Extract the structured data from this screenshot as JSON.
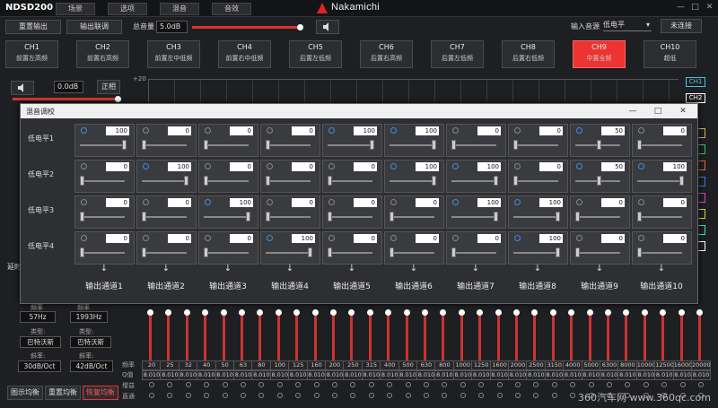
{
  "app_title": "NDSD200",
  "menu": [
    "场景",
    "选项",
    "混音",
    "音效"
  ],
  "logo": "Nakamichi",
  "window_controls": [
    "—",
    "□",
    "✕"
  ],
  "toolbar": {
    "reset_output": "重置输出",
    "output_link": "输出联调",
    "total_volume_label": "总音量",
    "total_volume_value": "5.0dB",
    "input_source_label": "输入音源",
    "input_source_value": "低电平",
    "connect_status": "未连接"
  },
  "channels": [
    {
      "name": "CH1",
      "sub": "前置左高频"
    },
    {
      "name": "CH2",
      "sub": "前置右高频"
    },
    {
      "name": "CH3",
      "sub": "前置左中低频"
    },
    {
      "name": "CH4",
      "sub": "前置右中低频"
    },
    {
      "name": "CH5",
      "sub": "后置左低频"
    },
    {
      "name": "CH6",
      "sub": "后置右高频"
    },
    {
      "name": "CH7",
      "sub": "后置左低频"
    },
    {
      "name": "CH8",
      "sub": "后置右低频"
    },
    {
      "name": "CH9",
      "sub": "中置全频"
    },
    {
      "name": "CH10",
      "sub": "超低"
    }
  ],
  "active_channel": "CH9",
  "channel_control": {
    "volume": "0.0dB",
    "phase": "正相"
  },
  "graph": {
    "y_top": "+20"
  },
  "side_channels": [
    "CH1",
    "CH2"
  ],
  "mixer": {
    "title": "混音调校",
    "rows": [
      "低电平1",
      "低电平2",
      "低电平3",
      "低电平4"
    ],
    "outputs": [
      "输出通道1",
      "输出通道2",
      "输出通道3",
      "输出通道4",
      "输出通道5",
      "输出通道6",
      "输出通道7",
      "输出通道8",
      "输出通道9",
      "输出通道10"
    ],
    "values": [
      [
        100,
        0,
        0,
        0,
        100,
        100,
        0,
        0,
        50,
        0
      ],
      [
        0,
        100,
        0,
        0,
        0,
        100,
        100,
        0,
        50,
        100
      ],
      [
        0,
        0,
        100,
        0,
        0,
        0,
        100,
        100,
        0,
        0
      ],
      [
        0,
        0,
        0,
        100,
        0,
        0,
        0,
        100,
        0,
        0
      ]
    ],
    "arrow": "↓"
  },
  "left_panel": {
    "delay_label": "延时",
    "hp_freq_label": "频率",
    "hp_freq": "57Hz",
    "lp_freq_label": "频率",
    "lp_freq": "1993Hz",
    "type_label": "类型:",
    "hp_type": "巴特沃斯",
    "lp_type": "巴特沃斯",
    "slope_label": "斜率:",
    "hp_slope": "30dB/Oct",
    "lp_slope": "42dB/Oct"
  },
  "eq": {
    "freq_label": "频率",
    "q_label": "Q值",
    "gain_label": "增益",
    "bypass_label": "直通",
    "freqs": [
      "20",
      "25",
      "32",
      "40",
      "50",
      "63",
      "80",
      "100",
      "125",
      "160",
      "200",
      "250",
      "315",
      "400",
      "500",
      "630",
      "800",
      "1000",
      "1250",
      "1600",
      "2000",
      "2500",
      "3150",
      "4000",
      "5000",
      "6300",
      "8000",
      "10000",
      "12500",
      "16000",
      "20000"
    ],
    "q": "8.010",
    "buttons": [
      "图示均衡",
      "重置均衡",
      "恢复均衡"
    ]
  },
  "watermark": "360汽车网  www.360qc.com"
}
